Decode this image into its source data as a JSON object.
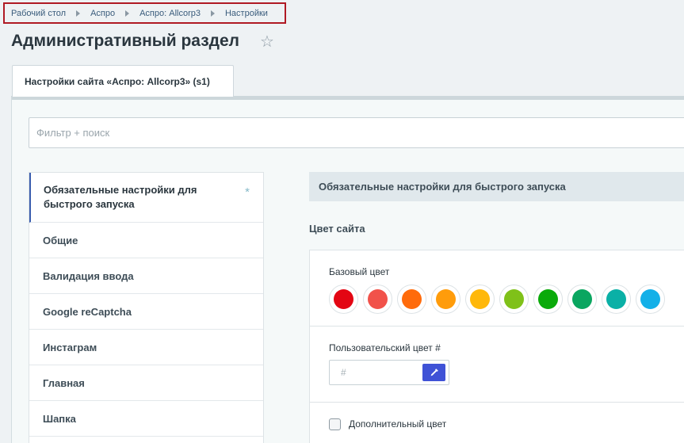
{
  "breadcrumb": [
    "Рабочий стол",
    "Аспро",
    "Аспро: Allcorp3",
    "Настройки"
  ],
  "page": {
    "title": "Административный раздел"
  },
  "tab": {
    "label": "Настройки сайта «Аспро: Allcorp3» (s1)"
  },
  "filter": {
    "placeholder": "Фильтр + поиск"
  },
  "sidebar": {
    "active_label": "Обязательные настройки для быстрого запуска",
    "active_marker": "*",
    "items": [
      "Общие",
      "Валидация ввода",
      "Google reCaptcha",
      "Инстаграм",
      "Главная",
      "Шапка"
    ]
  },
  "content": {
    "section_header": "Обязательные настройки для быстрого запуска",
    "site_color_title": "Цвет сайта",
    "base_color_label": "Базовый цвет",
    "base_colors": [
      "#e30613",
      "#f1524a",
      "#ff6b0b",
      "#ff9c0b",
      "#ffb80b",
      "#7fc119",
      "#0aaa0a",
      "#0aa660",
      "#0ab0a6",
      "#13b0e8"
    ],
    "custom_color_label": "Пользовательский цвет #",
    "custom_color_placeholder": "#",
    "extra_color_label": "Дополнительный цвет"
  },
  "icons": {
    "favorite": "star-icon",
    "picker": "eyedropper-icon"
  }
}
